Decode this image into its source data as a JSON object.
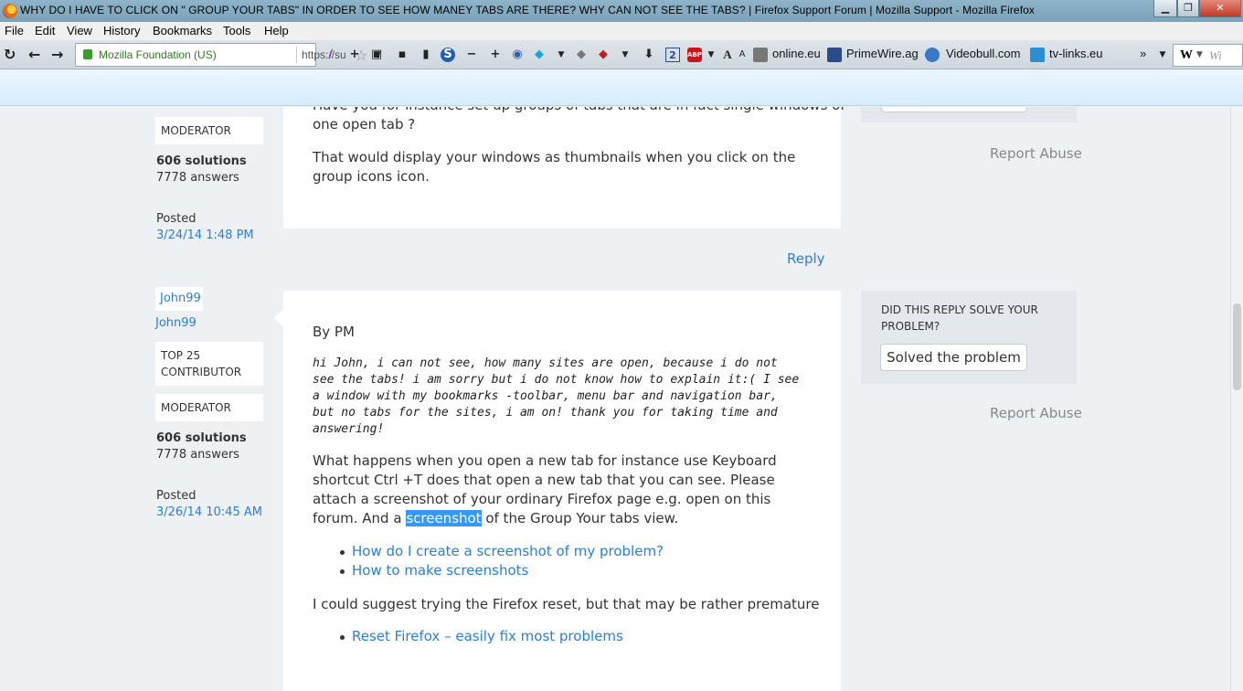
{
  "window": {
    "title": "WHY DO I HAVE TO CLICK ON \" GROUP YOUR TABS\" IN ORDER TO SEE HOW MANEY TABS ARE THERE? WHY CAN NOT SEE THE TABS? | Firefox Support Forum | Mozilla Support - Mozilla Firefox",
    "minimize": "▁",
    "restore": "❐",
    "close": "✕"
  },
  "menu": {
    "items": [
      "File",
      "Edit",
      "View",
      "History",
      "Bookmarks",
      "Tools",
      "Help"
    ]
  },
  "navbar": {
    "identity": "Mozilla Foundation (US)",
    "url": "https://su",
    "bookmarks": [
      "online.eu",
      "PrimeWire.ag",
      "Videobull.com",
      "tv-links.eu"
    ],
    "overflow": "»",
    "search_engine": "W",
    "search_placeholder": "Wi",
    "badge_count": "2"
  },
  "post1": {
    "badge_moderator": "MODERATOR",
    "solutions": "606 solutions",
    "answers": "7778 answers",
    "posted_label": "Posted",
    "posted_date": "3/24/14 1:48 PM",
    "line0": "Have you for instance set up groups of tabs that are in fact single windows of",
    "line0b": "one open tab ?",
    "para2": "That would display your windows as thumbnails when you click on the group icons icon.",
    "report": "Report Abuse",
    "reply": "Reply"
  },
  "post2": {
    "user_badge": "John99",
    "user_link": "John99",
    "badge_top": "TOP 25 CONTRIBUTOR",
    "badge_moderator": "MODERATOR",
    "solutions": "606 solutions",
    "answers": "7778 answers",
    "posted_label": "Posted",
    "posted_date": "3/26/14 10:45 AM",
    "by": "By PM",
    "quote": "hi John, i can not see, how many sites are open, because i do not see the tabs! i am sorry but i do not know how to explain it:( I see a window with my bookmarks -toolbar, menu bar and navigation bar, but no tabs for the sites, i am on! thank you for taking time and answering!",
    "body_before_hl": "What happens when you open a new tab for instance use Keyboard shortcut Ctrl +T does that open a new tab that you can see. Please attach a screenshot of your ordinary Firefox page e.g. open on this forum. And a ",
    "body_hl": "screenshot",
    "body_after_hl": " of the Group Your tabs view.",
    "link1": "How do I create a screenshot of my problem?",
    "link2": "How to make screenshots",
    "para_reset": "I could suggest trying the Firefox reset, but that may be rather premature",
    "link3": "Reset Firefox – easily fix most problems",
    "solve_title": "DID THIS REPLY SOLVE YOUR PROBLEM?",
    "solve_button": "Solved the problem",
    "report": "Report Abuse"
  }
}
